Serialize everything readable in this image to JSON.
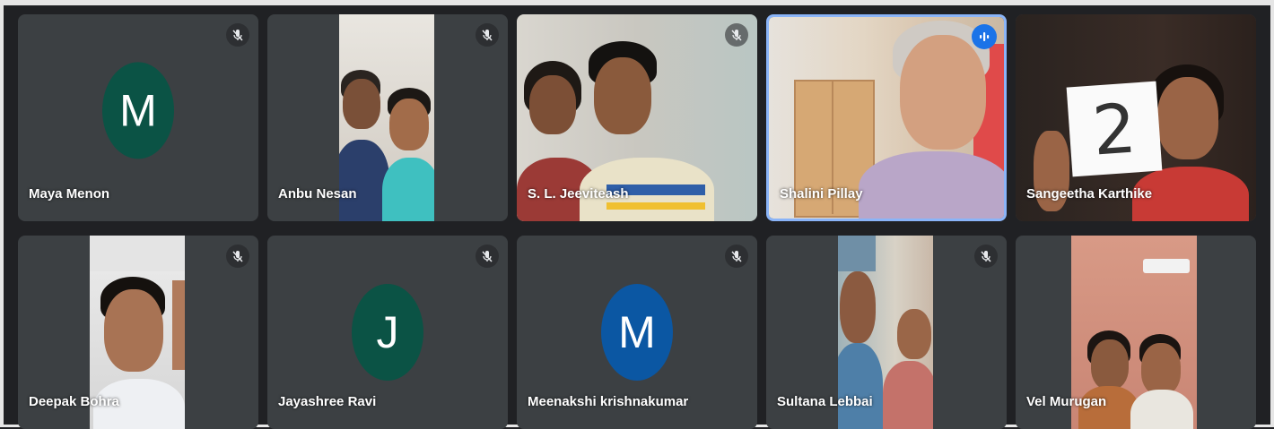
{
  "meeting": {
    "participants": [
      {
        "name": "Maya Menon",
        "initial": "M",
        "avatar_color": "#0b5345",
        "camera": false,
        "muted": true
      },
      {
        "name": "Anbu Nesan",
        "camera": true,
        "muted": true
      },
      {
        "name": "S. L. Jeeviteash",
        "camera": true,
        "muted": true
      },
      {
        "name": "Shalini Pillay",
        "camera": true,
        "muted": false,
        "speaking": true
      },
      {
        "name": "Sangeetha Karthike",
        "camera": true,
        "muted": false,
        "sign_text": "2"
      },
      {
        "name": "Deepak Bohra",
        "camera": true,
        "muted": true
      },
      {
        "name": "Jayashree Ravi",
        "initial": "J",
        "avatar_color": "#0b5345",
        "camera": false,
        "muted": true
      },
      {
        "name": "Meenakshi krishnakumar",
        "initial": "M",
        "avatar_color": "#0b57a3",
        "camera": false,
        "muted": true
      },
      {
        "name": "Sultana Lebbai",
        "camera": true,
        "muted": true
      },
      {
        "name": "Vel Murugan",
        "camera": true,
        "muted": false
      }
    ]
  },
  "icons": {
    "muted": "mic-off-icon",
    "speaking": "audio-level-icon"
  },
  "colors": {
    "tile": "#3c4043",
    "background": "#202124",
    "speaking_border": "#8ab4f8",
    "speaking_badge": "#1a73e8"
  }
}
